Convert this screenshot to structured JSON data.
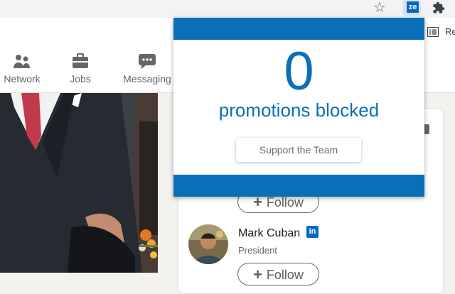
{
  "browser": {
    "reading_list_label": "Re"
  },
  "extension": {
    "badge_text": "ze",
    "brand_color": "#0a6fb9"
  },
  "nav": {
    "items": [
      {
        "label": "Network",
        "icon": "people-icon"
      },
      {
        "label": "Jobs",
        "icon": "briefcase-icon"
      },
      {
        "label": "Messaging",
        "icon": "chat-bubble-icon"
      }
    ],
    "partial_label": "ng"
  },
  "popup": {
    "count": "0",
    "count_label": "promotions blocked",
    "support_button": "Support the Team"
  },
  "card": {
    "follow_label": "Follow",
    "person": {
      "name": "Mark Cuban",
      "title": "President",
      "badge": "in"
    }
  }
}
